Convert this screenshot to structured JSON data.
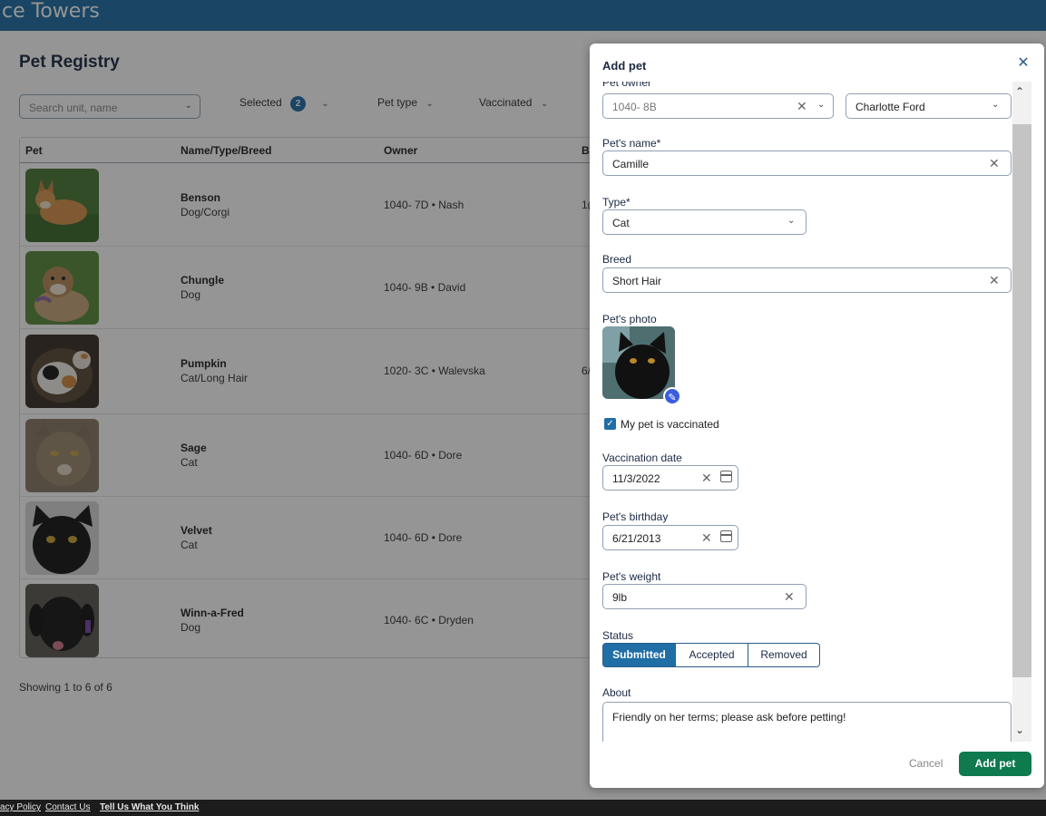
{
  "app": {
    "brand": "ce Towers"
  },
  "page": {
    "title": "Pet Registry",
    "search_placeholder": "Search unit, name",
    "filters": {
      "selected_label": "Selected",
      "selected_count": "2",
      "pet_type_label": "Pet type",
      "vaccinated_label": "Vaccinated"
    },
    "table": {
      "columns": [
        "Pet",
        "Name/Type/Breed",
        "Owner",
        "Bi"
      ],
      "rows": [
        {
          "name": "Benson",
          "type": "Dog/Corgi",
          "owner": "1040- 7D • Nash",
          "bday": "1("
        },
        {
          "name": "Chungle",
          "type": "Dog",
          "owner": "1040- 9B • David",
          "bday": ""
        },
        {
          "name": "Pumpkin",
          "type": "Cat/Long Hair",
          "owner": "1020- 3C • Walevska",
          "bday": "6/"
        },
        {
          "name": "Sage",
          "type": "Cat",
          "owner": "1040- 6D • Dore",
          "bday": ""
        },
        {
          "name": "Velvet",
          "type": "Cat",
          "owner": "1040- 6D • Dore",
          "bday": ""
        },
        {
          "name": "Winn-a-Fred",
          "type": "Dog",
          "owner": "1040- 6C • Dryden",
          "bday": ""
        }
      ]
    },
    "showing": "Showing 1 to 6 of 6"
  },
  "modal": {
    "title": "Add pet",
    "owner": {
      "label": "Pet owner",
      "unit": "1040- 8B",
      "person": "Charlotte Ford"
    },
    "name": {
      "label": "Pet's name*",
      "value": "Camille"
    },
    "type": {
      "label": "Type*",
      "value": "Cat"
    },
    "breed": {
      "label": "Breed",
      "value": "Short Hair"
    },
    "photo": {
      "label": "Pet's photo"
    },
    "vaccinated": {
      "label": "My pet is vaccinated",
      "checked": true
    },
    "vaccination_date": {
      "label": "Vaccination date",
      "value": "11/3/2022"
    },
    "birthday": {
      "label": "Pet's birthday",
      "value": "6/21/2013"
    },
    "weight": {
      "label": "Pet's weight",
      "value": "9lb"
    },
    "status": {
      "label": "Status",
      "options": [
        "Submitted",
        "Accepted",
        "Removed"
      ],
      "selected": "Submitted"
    },
    "about": {
      "label": "About",
      "value": "Friendly on her terms; please ask before petting!"
    },
    "cancel_label": "Cancel",
    "submit_label": "Add pet"
  },
  "footer": {
    "links": [
      "acy Policy",
      "Contact Us",
      "Tell Us What You Think"
    ]
  },
  "colors": {
    "header": "#1f6ea6",
    "primary_button": "#0f7a4e",
    "accent": "#1f6ea6"
  }
}
